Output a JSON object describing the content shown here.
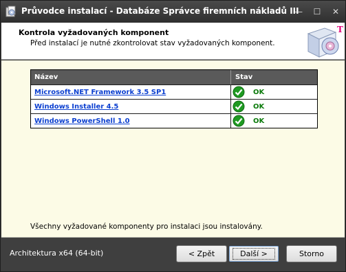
{
  "window": {
    "title": "Průvodce instalací - Databáze Správce firemních nákladů III",
    "controls": {
      "minimize": "—",
      "maximize": "☐",
      "close": "✕"
    }
  },
  "header": {
    "title": "Kontrola vyžadovaných komponent",
    "subtitle": "Před instalací je nutné zkontrolovat stav vyžadovaných komponent.",
    "brand_mark": "T"
  },
  "components": {
    "columns": [
      "Název",
      "Stav"
    ],
    "rows": [
      {
        "name": "Microsoft.NET Framework 3.5 SP1",
        "status": "OK"
      },
      {
        "name": "Windows Installer 4.5",
        "status": "OK"
      },
      {
        "name": "Windows PowerShell 1.0",
        "status": "OK"
      }
    ]
  },
  "footer_note": "Všechny vyžadované komponenty pro instalaci jsou instalovány.",
  "bottom": {
    "architecture": "Architektura x64 (64-bit)",
    "back_label": "< Zpět",
    "next_label": "Další >",
    "cancel_label": "Storno"
  },
  "colors": {
    "frame": "#3f3f3f",
    "content_bg": "#fcfbe6",
    "grid_header": "#5a5a5a",
    "link": "#0b3fd0",
    "ok": "#0a7a0a",
    "brand": "#e2007a"
  }
}
